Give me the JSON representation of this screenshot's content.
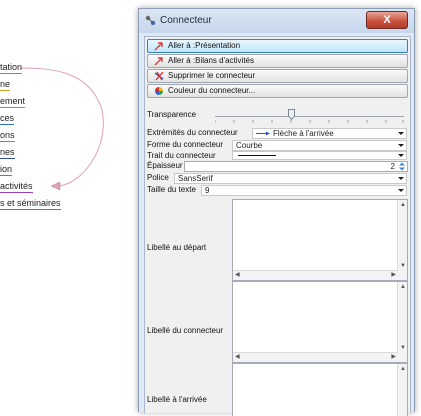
{
  "mindmap": {
    "nodes": [
      {
        "label": "tation"
      },
      {
        "label": "ne"
      },
      {
        "label": "ement"
      },
      {
        "label": "ces"
      },
      {
        "label": "ons"
      },
      {
        "label": "nes"
      },
      {
        "label": "ion"
      },
      {
        "label": "activités"
      },
      {
        "label": "s et séminaires"
      }
    ]
  },
  "dialog": {
    "title": "Connecteur",
    "close_label": "X",
    "buttons": {
      "goto_presentation": "Aller à :Présentation",
      "goto_bilans": "Aller à :Bilans d'activités",
      "delete_connector": "Supprimer le connecteur",
      "connector_color": "Couleur du connecteur..."
    },
    "transparency": {
      "label": "Transparence",
      "level_percent": 40
    },
    "endpoints": {
      "label": "Extrémités du connecteur",
      "value": "Flèche à l'arrivée"
    },
    "shape": {
      "label": "Forme du connecteur",
      "value": "Courbe"
    },
    "stroke": {
      "label": "Trait du connecteur"
    },
    "thickness": {
      "label": "Épaisseur",
      "value": "2"
    },
    "font": {
      "label": "Police",
      "value": "SansSerif"
    },
    "text_size": {
      "label": "Taille du texte",
      "value": "9"
    },
    "label_start": {
      "label": "Libellé au départ",
      "value": ""
    },
    "label_connector": {
      "label": "Libellé du connecteur",
      "value": ""
    },
    "label_end": {
      "label": "Libellé à l'arrivée",
      "value": ""
    }
  },
  "colors": {
    "accent": "#3c7fb1",
    "close_button": "#c84f3a",
    "link_curve": "#e0a0b8"
  }
}
